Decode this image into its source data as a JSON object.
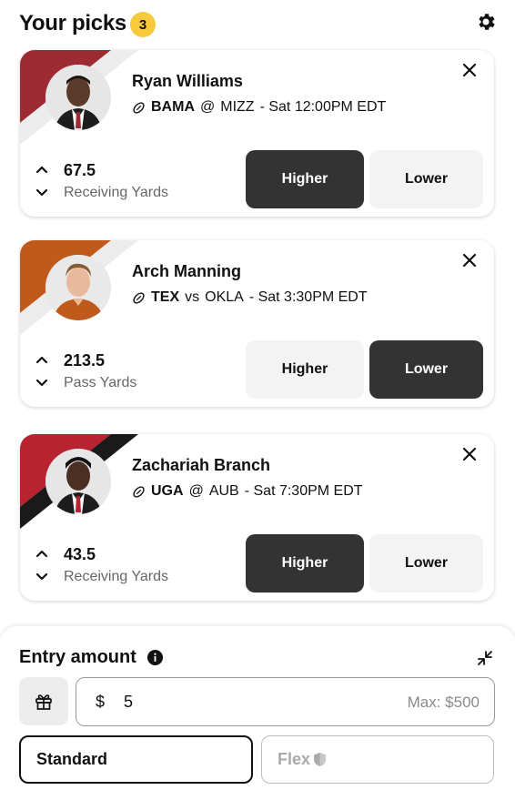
{
  "header": {
    "title": "Your picks",
    "count": "3",
    "settings_icon": "gear-icon"
  },
  "picks": [
    {
      "name": "Ryan Williams",
      "team": "BAMA",
      "separator": "@",
      "opponent": "MIZZ",
      "time": "- Sat 12:00PM EDT",
      "stat_value": "67.5",
      "stat_label": "Receiving Yards",
      "higher_label": "Higher",
      "lower_label": "Lower",
      "selected": "higher",
      "colors": {
        "stripe": "#9e2a33",
        "skin": "#5a3a28",
        "shirt": "#ffffff",
        "tie": "#9e2a33"
      }
    },
    {
      "name": "Arch Manning",
      "team": "TEX",
      "separator": "vs",
      "opponent": "OKLA",
      "time": "- Sat 3:30PM EDT",
      "stat_value": "213.5",
      "stat_label": "Pass Yards",
      "higher_label": "Higher",
      "lower_label": "Lower",
      "selected": "lower",
      "colors": {
        "stripe": "#bf5a1c",
        "skin": "#e8b99a",
        "shirt": "#bf5a1c",
        "tie": "#bf5a1c"
      }
    },
    {
      "name": "Zachariah Branch",
      "team": "UGA",
      "separator": "@",
      "opponent": "AUB",
      "time": "- Sat 7:30PM EDT",
      "stat_value": "43.5",
      "stat_label": "Receiving Yards",
      "higher_label": "Higher",
      "lower_label": "Lower",
      "selected": "higher",
      "colors": {
        "stripe": "#b8232f",
        "skin": "#4a2f22",
        "shirt": "#ffffff",
        "tie": "#b8232f"
      }
    }
  ],
  "entry": {
    "title": "Entry amount",
    "currency": "$",
    "amount": "5",
    "max_label": "Max: $500",
    "standard_label": "Standard",
    "flex_label": "Flex",
    "selected_mode": "standard"
  },
  "colors": {
    "accent_dark": "#333333",
    "badge": "#f7c93d"
  }
}
